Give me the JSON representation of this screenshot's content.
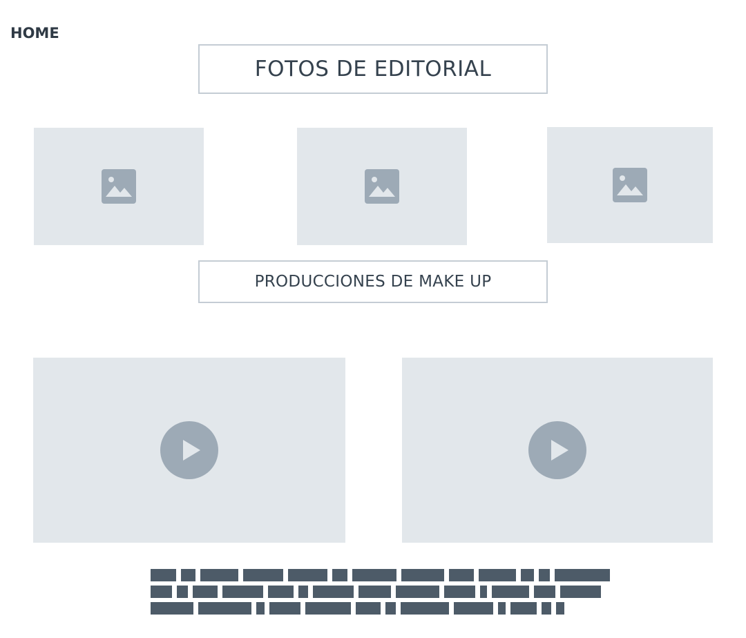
{
  "nav": {
    "home_label": "HOME"
  },
  "sections": {
    "editorial_label": "FOTOS DE EDITORIAL",
    "makeup_label": "PRODUCCIONES DE MAKE UP"
  },
  "icons": {
    "image_placeholder": "image-icon",
    "video_placeholder": "play-icon"
  },
  "colors": {
    "placeholder_bg": "#e2e7eb",
    "icon_fill": "#9daab6",
    "text_redacted": "#4d5b68",
    "button_border": "#c4ccd4",
    "text": "#35424e"
  }
}
